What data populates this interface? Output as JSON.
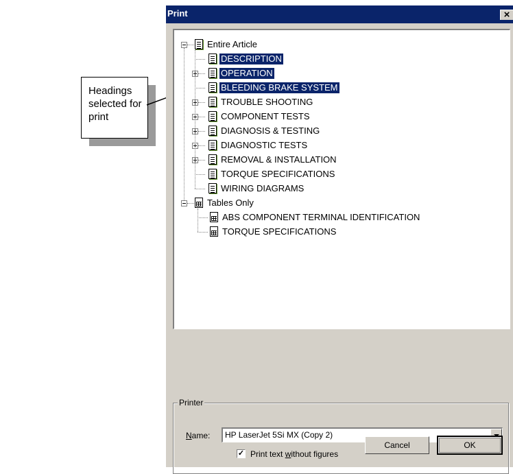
{
  "callout": {
    "text_line1": "Headings",
    "text_line2": "selected for print"
  },
  "dialog": {
    "title": "Print",
    "close_glyph": "×",
    "tree": {
      "root_article": "Entire Article",
      "article_items": [
        {
          "label": "DESCRIPTION",
          "selected": true,
          "expandable": false
        },
        {
          "label": "OPERATION",
          "selected": true,
          "expandable": true
        },
        {
          "label": "BLEEDING BRAKE SYSTEM",
          "selected": true,
          "expandable": false
        },
        {
          "label": "TROUBLE SHOOTING",
          "selected": false,
          "expandable": true
        },
        {
          "label": "COMPONENT TESTS",
          "selected": false,
          "expandable": true
        },
        {
          "label": "DIAGNOSIS & TESTING",
          "selected": false,
          "expandable": true
        },
        {
          "label": "DIAGNOSTIC TESTS",
          "selected": false,
          "expandable": true
        },
        {
          "label": "REMOVAL & INSTALLATION",
          "selected": false,
          "expandable": true
        },
        {
          "label": "TORQUE SPECIFICATIONS",
          "selected": false,
          "expandable": false
        },
        {
          "label": "WIRING DIAGRAMS",
          "selected": false,
          "expandable": false
        }
      ],
      "root_tables": "Tables Only",
      "table_items": [
        {
          "label": "ABS COMPONENT TERMINAL IDENTIFICATION"
        },
        {
          "label": "TORQUE SPECIFICATIONS"
        }
      ]
    },
    "printer": {
      "group_label": "Printer",
      "name_label_prefix": "",
      "name_label_mnemonic": "N",
      "name_label_rest": "ame:",
      "name_value": "HP LaserJet 5Si MX (Copy 2)",
      "checkbox_checked": true,
      "checkbox_label_pre": "Print text ",
      "checkbox_label_mnemonic": "w",
      "checkbox_label_post": "ithout figures"
    },
    "buttons": {
      "cancel": "Cancel",
      "ok": "OK"
    }
  }
}
